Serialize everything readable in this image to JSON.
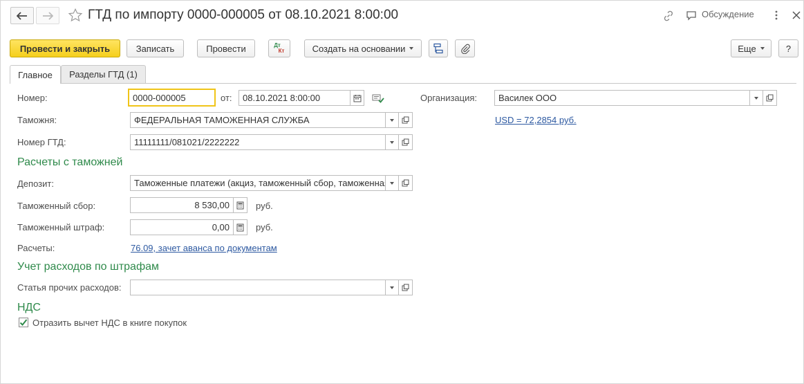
{
  "window": {
    "title": "ГТД по импорту 0000-000005 от 08.10.2021 8:00:00",
    "discussion": "Обсуждение"
  },
  "toolbar": {
    "post_and_close": "Провести и закрыть",
    "save": "Записать",
    "post": "Провести",
    "dtkt_top": "Дт",
    "dtkt_bottom": "Кт",
    "create_based_on": "Создать на основании",
    "more": "Еще",
    "help": "?"
  },
  "tabs": [
    {
      "label": "Главное",
      "active": true
    },
    {
      "label": "Разделы ГТД (1)",
      "active": false
    }
  ],
  "form": {
    "number_label": "Номер:",
    "number_value": "0000-000005",
    "from_label": "от:",
    "date_value": "08.10.2021  8:00:00",
    "org_label": "Организация:",
    "org_value": "Василек ООО",
    "customs_label": "Таможня:",
    "customs_value": "ФЕДЕРАЛЬНАЯ ТАМОЖЕННАЯ СЛУЖБА",
    "currency_link": "USD = 72,2854 руб.",
    "gtd_label": "Номер ГТД:",
    "gtd_value": "11111111/081021/2222222",
    "section_settlements": "Расчеты с таможней",
    "deposit_label": "Депозит:",
    "deposit_value": "Таможенные платежи (акциз, таможенный сбор, таможенная пошлина)",
    "fee_label": "Таможенный сбор:",
    "fee_value": "8 530,00",
    "fee_unit": "руб.",
    "fine_label": "Таможенный штраф:",
    "fine_value": "0,00",
    "fine_unit": "руб.",
    "settlements_label": "Расчеты:",
    "settlements_link": "76.09, зачет аванса по документам",
    "section_fines": "Учет расходов по штрафам",
    "expense_label": "Статья прочих расходов:",
    "expense_value": "",
    "section_vat": "НДС",
    "vat_checkbox_label": "Отразить вычет НДС в книге покупок",
    "vat_checkbox_checked": true
  },
  "colors": {
    "primary_button": "#f5cf1c",
    "section_heading": "#2f8a4b",
    "link": "#2d59a1",
    "focus_border": "#f0c418"
  }
}
